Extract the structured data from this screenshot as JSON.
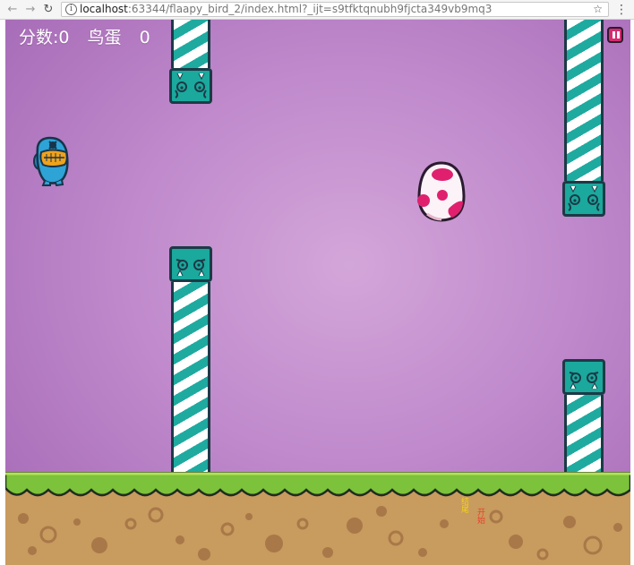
{
  "browser": {
    "back_glyph": "←",
    "forward_glyph": "→",
    "reload_glyph": "↻",
    "info_glyph": "i",
    "url_host": "localhost",
    "url_rest": ":63344/flaapy_bird_2/index.html?_ijt=s9tfktqnubh9fjcta349vb9mq3",
    "star_glyph": "☆",
    "menu_glyph": "⋮"
  },
  "hud": {
    "score_label": "分数:0",
    "egg_label": "鸟蛋",
    "egg_count": "0"
  },
  "ground": {
    "label_end": "结尾",
    "label_start": "开始",
    "label_end_color": "#f2d21b",
    "label_start_color": "#e8412c"
  },
  "colors": {
    "sky_center": "#d3a6d9",
    "sky_edge": "#a367b4",
    "pipe_teal": "#1faaa0",
    "pipe_outline": "#1c3a46",
    "grass": "#7cc23a",
    "dirt": "#c89b5e",
    "bird": "#2ea3d6",
    "egg_spots": "#e0206e",
    "pause_button": "#d62b6f"
  },
  "icons": {
    "bird": "blue-monster-bird-icon",
    "egg": "pink-spotted-egg-icon",
    "pause": "pause-icon"
  }
}
